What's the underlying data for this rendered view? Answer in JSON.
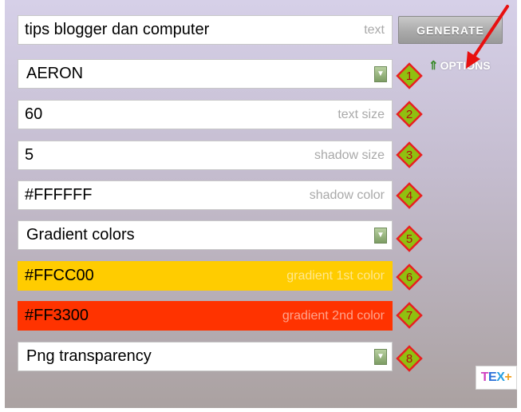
{
  "text_input": {
    "value": "tips blogger dan computer",
    "hint": "text"
  },
  "generate_button": {
    "label": "GENERATE"
  },
  "options_link": {
    "arrow": "⇑",
    "label": "OPTIONS"
  },
  "font_select": {
    "value": "AERON",
    "badge": "1"
  },
  "text_size": {
    "value": "60",
    "hint": "text size",
    "badge": "2"
  },
  "shadow_size": {
    "value": "5",
    "hint": "shadow size",
    "badge": "3"
  },
  "shadow_color": {
    "value": "#FFFFFF",
    "hint": "shadow color",
    "badge": "4"
  },
  "color_mode_select": {
    "value": "Gradient colors",
    "badge": "5"
  },
  "gradient_1": {
    "value": "#FFCC00",
    "hint": "gradient 1st color",
    "badge": "6",
    "bg": "#FFCC00"
  },
  "gradient_2": {
    "value": "#FF3300",
    "hint": "gradient 2nd color",
    "badge": "7",
    "bg": "#FF3300"
  },
  "format_select": {
    "value": "Png transparency",
    "badge": "8"
  },
  "logo": {
    "parts": [
      "T",
      "E",
      "X",
      "+"
    ]
  },
  "colors": {
    "badge_fill": "#90c010",
    "badge_stroke": "#e82020",
    "badge_text": "#b01010",
    "annotation_arrow": "#e81010"
  }
}
